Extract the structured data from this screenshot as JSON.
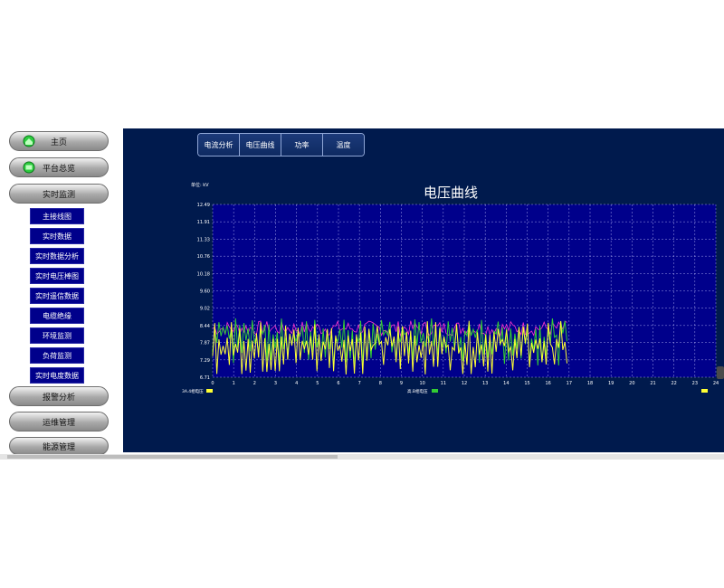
{
  "sidebar": {
    "top_items": [
      {
        "label": "主页",
        "icon": "home-icon"
      },
      {
        "label": "平台总览",
        "icon": "overview-icon"
      },
      {
        "label": "实时监测"
      }
    ],
    "sub_items": [
      "主接线图",
      "实时数据",
      "实时数据分析",
      "实时电压棒图",
      "实时遥信数据",
      "电缆绝缘",
      "环境监测",
      "负荷监测",
      "实时电度数据"
    ],
    "bottom_items": [
      "报警分析",
      "运维管理",
      "能源管理"
    ]
  },
  "tabs": [
    "电流分析",
    "电压曲线",
    "功率",
    "温度"
  ],
  "colors": {
    "panel_bg": "#001a4d",
    "plot_bg": "#00008b",
    "series_yellow": "#ffff33",
    "series_green": "#33cc33",
    "series_magenta": "#ff33cc"
  },
  "chart_data": {
    "type": "line",
    "title": "电压曲线",
    "unit_label": "单位: kV",
    "xlim": [
      0,
      24
    ],
    "ylim": [
      6.71,
      12.49
    ],
    "x_ticks": [
      0,
      1,
      2,
      3,
      4,
      5,
      6,
      7,
      8,
      9,
      10,
      11,
      12,
      13,
      14,
      15,
      16,
      17,
      18,
      19,
      20,
      21,
      22,
      23,
      24
    ],
    "y_ticks": [
      "6.71",
      "7.29",
      "7.87",
      "8.44",
      "9.02",
      "9.60",
      "10.18",
      "10.76",
      "11.33",
      "11.91",
      "12.49"
    ],
    "legend": [
      {
        "name": "3A.4相电压",
        "color": "#ffff33"
      },
      {
        "name": "高.B相电压",
        "color": "#33cc33"
      },
      {
        "name": "",
        "color": "#ffff33"
      }
    ],
    "series": [
      {
        "color": "#ffff33",
        "x_range": [
          0,
          16.9
        ],
        "min": 6.8,
        "max": 8.6,
        "approx_mean": 7.7
      },
      {
        "color": "#33cc33",
        "x_range": [
          0,
          16.9
        ],
        "min": 7.1,
        "max": 8.7,
        "approx_mean": 8.0
      },
      {
        "color": "#ff33cc",
        "x_range": [
          0,
          16.9
        ],
        "min": 8.1,
        "max": 8.6,
        "approx_mean": 8.35
      }
    ]
  }
}
